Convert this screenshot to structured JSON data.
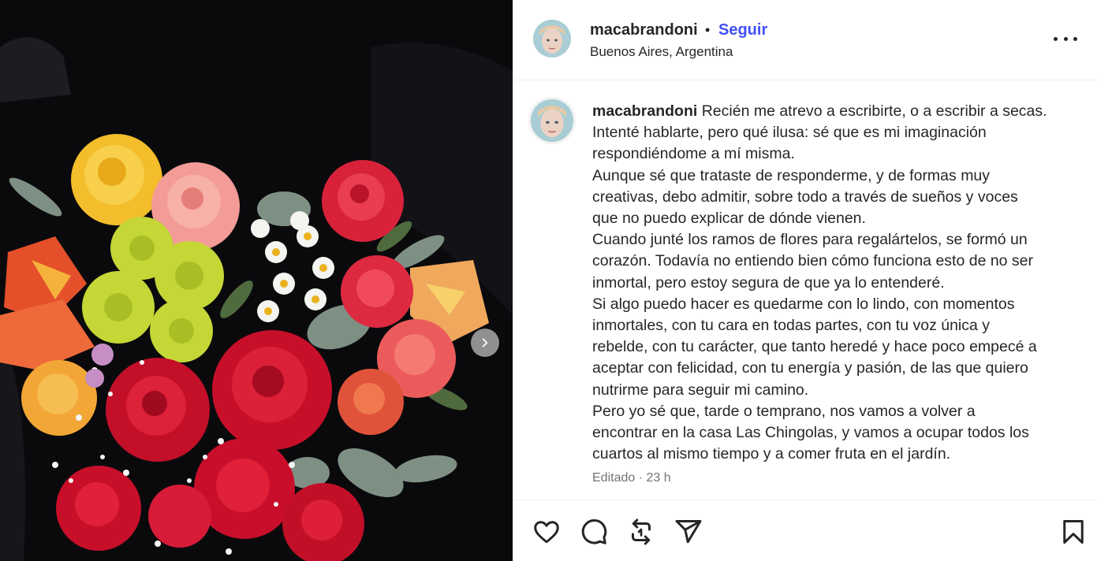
{
  "post": {
    "username": "macabrandoni",
    "separator": "•",
    "follow_label": "Seguir",
    "location": "Buenos Aires, Argentina",
    "caption_lines": [
      "Recién me atrevo a escribirte, o a escribir a secas.",
      "Intenté hablarte, pero qué ilusa: sé que es mi imaginación",
      "respondiéndome a mí misma.",
      "Aunque sé que trataste de responderme, y de formas muy",
      "creativas, debo admitir, sobre todo a través de sueños y voces",
      "que no puedo explicar de dónde vienen.",
      "Cuando junté los ramos de flores para regalártelos, se formó un",
      "corazón. Todavía no entiendo bien cómo funciona esto de no ser",
      "inmortal, pero estoy segura de que ya lo entenderé.",
      "Si algo puedo hacer es quedarme con lo lindo, con momentos",
      "inmortales, con tu cara en todas partes, con tu voz única y",
      "rebelde, con tu carácter, que tanto heredé y hace poco empecé a",
      "aceptar con felicidad, con tu energía y pasión, de las que quiero",
      "nutrirme para seguir mi camino.",
      "Pero yo sé que, tarde o temprano, nos vamos a volver a",
      "encontrar en la casa Las Chingolas, y vamos a ocupar todos los",
      "cuartos al mismo tiempo y a comer fruta en el jardín."
    ],
    "meta": "Editado · 23 h"
  },
  "icons": {
    "next": "chevron-right-icon",
    "more": "more-horizontal-icon",
    "like": "heart-icon",
    "comment": "comment-bubble-icon",
    "repost": "repost-icon",
    "share": "send-icon",
    "save": "bookmark-icon"
  },
  "colors": {
    "link_blue": "#4150f7",
    "text": "#262626",
    "muted": "#737373"
  }
}
